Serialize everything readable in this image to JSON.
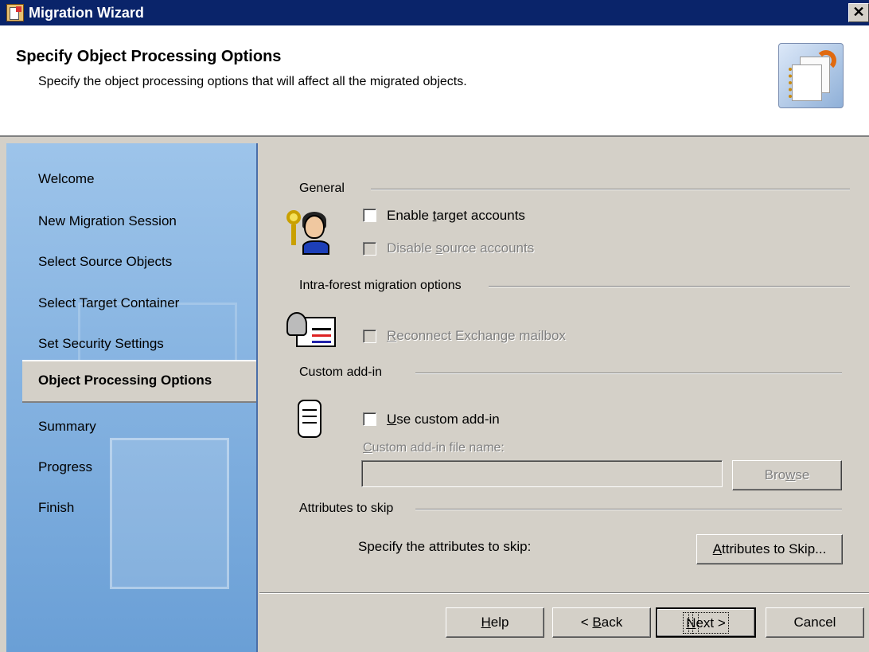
{
  "window": {
    "title": "Migration Wizard",
    "close_glyph": "✕"
  },
  "header": {
    "title": "Specify Object Processing Options",
    "subtitle": "Specify the object processing options that will affect all the migrated objects."
  },
  "sidebar": {
    "items": [
      {
        "label": "Welcome"
      },
      {
        "label": "New Migration Session"
      },
      {
        "label": "Select Source Objects"
      },
      {
        "label": "Select Target Container"
      },
      {
        "label": "Set Security Settings"
      },
      {
        "label": "Object Processing Options",
        "active": true
      },
      {
        "label": "Summary"
      },
      {
        "label": "Progress"
      },
      {
        "label": "Finish"
      }
    ]
  },
  "main": {
    "general": {
      "label": "General",
      "enable_target": {
        "pre": "Enable ",
        "u": "t",
        "post": "arget accounts",
        "checked": false
      },
      "disable_source": {
        "pre": "Disable ",
        "u": "s",
        "post": "ource accounts",
        "checked": false,
        "disabled": true
      }
    },
    "intra_forest": {
      "label": "Intra-forest migration options",
      "reconnect": {
        "pre": "",
        "u": "R",
        "post": "econnect Exchange mailbox",
        "checked": false,
        "disabled": true
      }
    },
    "custom_addin": {
      "label": "Custom add-in",
      "use_custom": {
        "pre": "",
        "u": "U",
        "post": "se custom add-in",
        "checked": false
      },
      "file_label": {
        "pre": "",
        "u": "C",
        "post": "ustom add-in file name:"
      },
      "file_value": "",
      "browse": {
        "pre": "Bro",
        "u": "w",
        "post": "se"
      }
    },
    "attributes": {
      "label": "Attributes to skip",
      "prompt": "Specify the attributes to skip:",
      "button": {
        "pre": "",
        "u": "A",
        "post": "ttributes to Skip..."
      }
    }
  },
  "footer": {
    "help": {
      "pre": "",
      "u": "H",
      "post": "elp"
    },
    "back": {
      "pre": "< ",
      "u": "B",
      "post": "ack"
    },
    "next": {
      "pre": "",
      "u": "N",
      "post": "ext >"
    },
    "cancel": "Cancel"
  }
}
